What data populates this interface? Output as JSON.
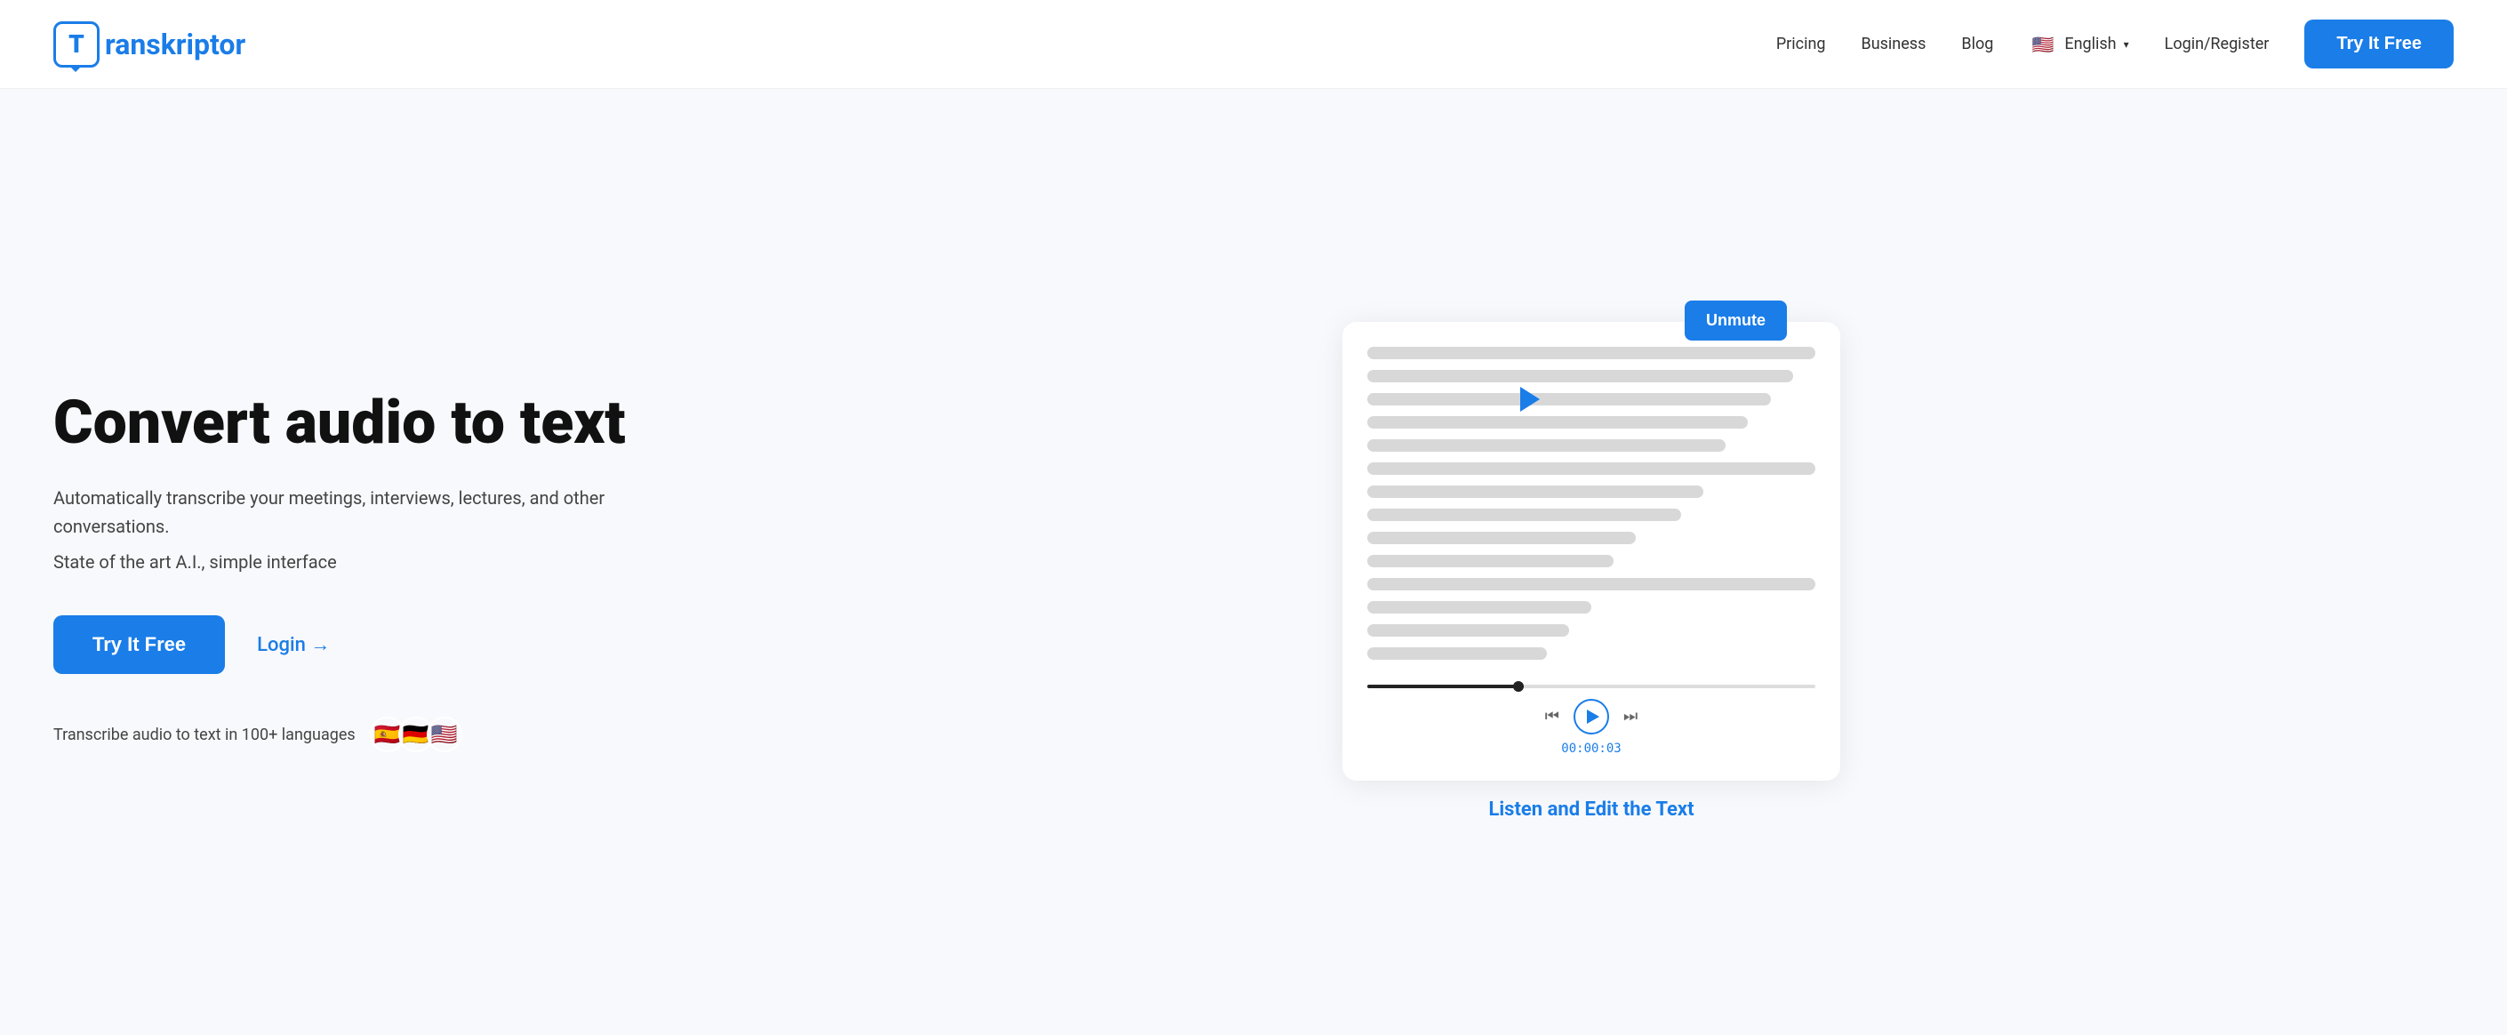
{
  "header": {
    "logo_letter": "T",
    "logo_text": "ranskriptor",
    "nav": {
      "pricing": "Pricing",
      "business": "Business",
      "blog": "Blog",
      "lang": "English",
      "lang_flag": "🇺🇸",
      "login": "Login/Register",
      "try_btn": "Try It Free"
    }
  },
  "hero": {
    "title": "Convert audio to text",
    "desc1": "Automatically transcribe your meetings, interviews, lectures, and other conversations.",
    "desc2": "State of the art A.I., simple interface",
    "try_btn": "Try It Free",
    "login_btn": "Login →",
    "lang_text": "Transcribe audio to text in 100+ languages",
    "flags": [
      "🇪🇸",
      "🇩🇪",
      "🇺🇸"
    ],
    "flag_colors": [
      "#e8c012",
      "#222",
      "#b22234"
    ]
  },
  "player": {
    "unmute_btn": "Unmute",
    "time": "00:00:03",
    "listen_edit": "Listen and Edit the Text"
  }
}
